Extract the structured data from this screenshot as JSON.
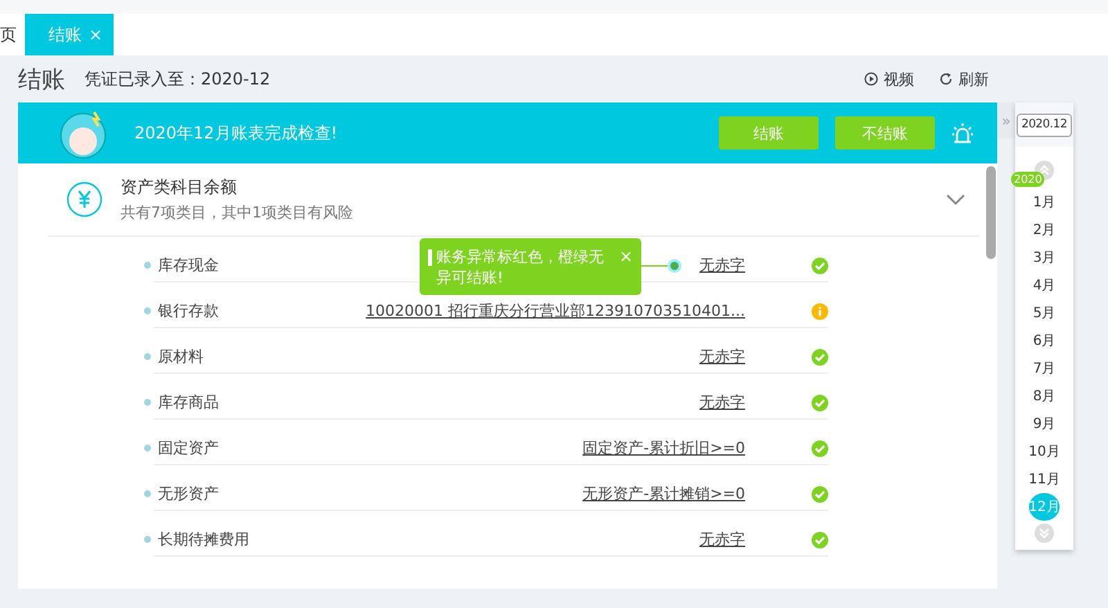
{
  "tabs": [
    {
      "label": "页",
      "selected": false
    },
    {
      "label": "结账",
      "selected": true,
      "close": "×"
    }
  ],
  "page": {
    "title": "结账",
    "voucher_status": "凭证已录入至：2020-12",
    "actions": [
      {
        "kind": "video",
        "label": "视频"
      },
      {
        "kind": "refresh",
        "label": "刷新"
      }
    ]
  },
  "banner": {
    "message": "2020年12月账表完成检查!",
    "buttons": [
      {
        "label": "结账"
      },
      {
        "label": "不结账"
      }
    ]
  },
  "sections": [
    {
      "title": "资产类科目余额",
      "summary": "共有7项类目，其中1项类目有风险",
      "expanded": true,
      "items": [
        {
          "name": "库存现金",
          "value": "无赤字",
          "risk": false,
          "tooltip": {
            "text": "账务异常标红色，橙绿无异可结账!",
            "close": "×"
          }
        },
        {
          "name": "银行存款",
          "value": "10020001 招行重庆分行营业部123910703510401...",
          "risk": true
        },
        {
          "name": "原材料",
          "value": "无赤字",
          "risk": false
        },
        {
          "name": "库存商品",
          "value": "无赤字",
          "risk": false
        },
        {
          "name": "固定资产",
          "value": "固定资产-累计折旧>=0",
          "risk": false
        },
        {
          "name": "无形资产",
          "value": "无形资产-累计摊销>=0",
          "risk": false
        },
        {
          "name": "长期待摊费用",
          "value": "无赤字",
          "risk": false
        }
      ]
    }
  ],
  "calendar": {
    "collapse": "»",
    "period": "2020.12",
    "year_badge": "2020",
    "months": [
      {
        "label": "1月",
        "selected": false
      },
      {
        "label": "2月",
        "selected": false
      },
      {
        "label": "3月",
        "selected": false
      },
      {
        "label": "4月",
        "selected": false
      },
      {
        "label": "5月",
        "selected": false
      },
      {
        "label": "6月",
        "selected": false
      },
      {
        "label": "7月",
        "selected": false
      },
      {
        "label": "8月",
        "selected": false
      },
      {
        "label": "9月",
        "selected": false
      },
      {
        "label": "10月",
        "selected": false
      },
      {
        "label": "11月",
        "selected": false
      },
      {
        "label": "12月",
        "selected": true
      }
    ]
  }
}
